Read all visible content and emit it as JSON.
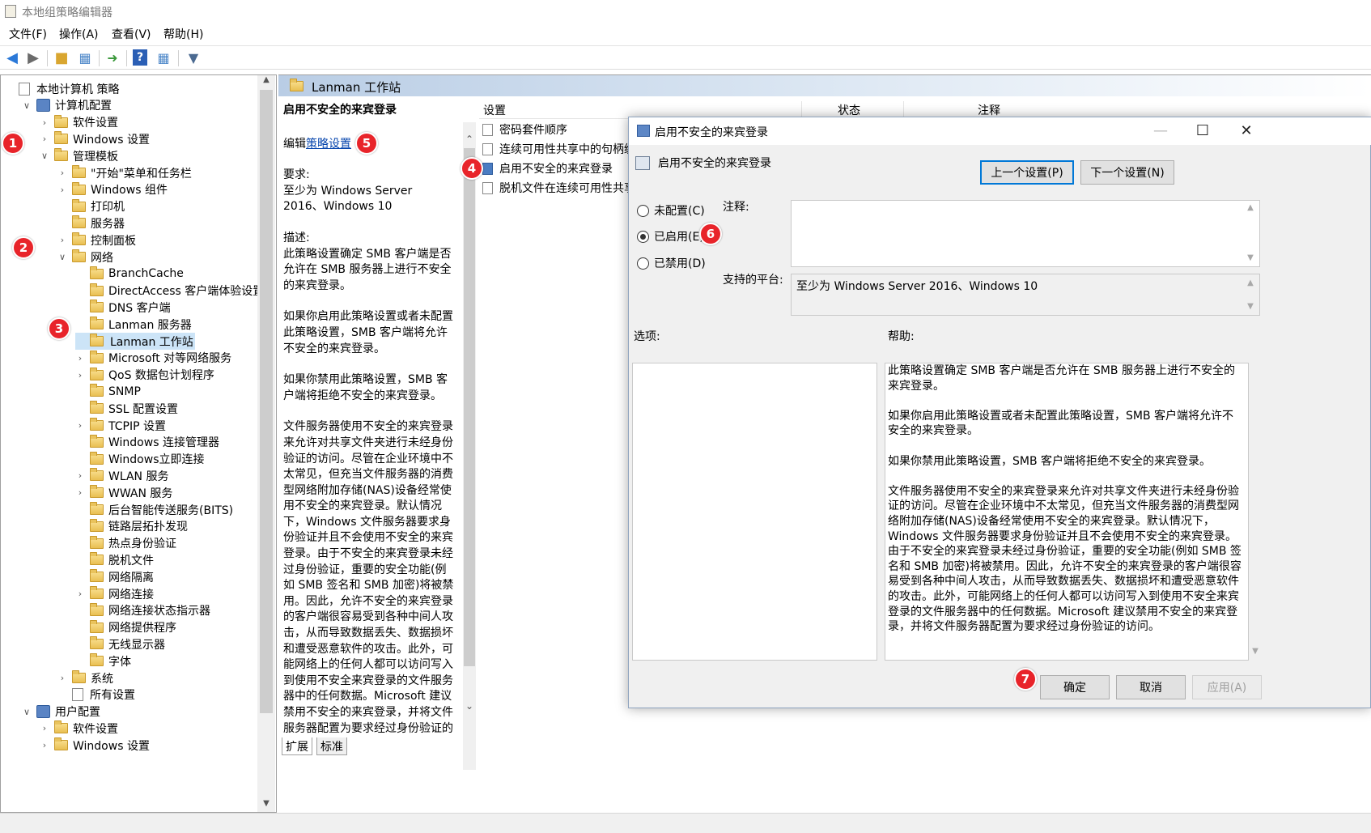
{
  "window": {
    "title": "本地组策略编辑器"
  },
  "menu": [
    "文件(F)",
    "操作(A)",
    "查看(V)",
    "帮助(H)"
  ],
  "toolbar_icons": [
    "back-icon",
    "forward-icon",
    "up-folder-icon",
    "show-hide-tree-icon",
    "export-list-icon",
    "help-icon",
    "show-hide-pane-icon",
    "filter-icon"
  ],
  "tree": [
    {
      "label": "本地计算机 策略",
      "depth": 0,
      "chev": "",
      "icon": "doc"
    },
    {
      "label": "计算机配置",
      "depth": 1,
      "chev": "v",
      "icon": "node"
    },
    {
      "label": "软件设置",
      "depth": 2,
      "chev": ">",
      "icon": "folder"
    },
    {
      "label": "Windows 设置",
      "depth": 2,
      "chev": ">",
      "icon": "folder"
    },
    {
      "label": "管理模板",
      "depth": 2,
      "chev": "v",
      "icon": "folder"
    },
    {
      "label": "\"开始\"菜单和任务栏",
      "depth": 3,
      "chev": ">",
      "icon": "folder"
    },
    {
      "label": "Windows 组件",
      "depth": 3,
      "chev": ">",
      "icon": "folder"
    },
    {
      "label": "打印机",
      "depth": 3,
      "chev": "",
      "icon": "folder"
    },
    {
      "label": "服务器",
      "depth": 3,
      "chev": "",
      "icon": "folder"
    },
    {
      "label": "控制面板",
      "depth": 3,
      "chev": ">",
      "icon": "folder"
    },
    {
      "label": "网络",
      "depth": 3,
      "chev": "v",
      "icon": "folder"
    },
    {
      "label": "BranchCache",
      "depth": 4,
      "chev": "",
      "icon": "folder"
    },
    {
      "label": "DirectAccess 客户端体验设置",
      "depth": 4,
      "chev": "",
      "icon": "folder"
    },
    {
      "label": "DNS 客户端",
      "depth": 4,
      "chev": "",
      "icon": "folder"
    },
    {
      "label": "Lanman 服务器",
      "depth": 4,
      "chev": "",
      "icon": "folder"
    },
    {
      "label": "Lanman 工作站",
      "depth": 4,
      "chev": "",
      "icon": "folder",
      "selected": true
    },
    {
      "label": "Microsoft 对等网络服务",
      "depth": 4,
      "chev": ">",
      "icon": "folder"
    },
    {
      "label": "QoS 数据包计划程序",
      "depth": 4,
      "chev": ">",
      "icon": "folder"
    },
    {
      "label": "SNMP",
      "depth": 4,
      "chev": "",
      "icon": "folder"
    },
    {
      "label": "SSL 配置设置",
      "depth": 4,
      "chev": "",
      "icon": "folder"
    },
    {
      "label": "TCPIP 设置",
      "depth": 4,
      "chev": ">",
      "icon": "folder"
    },
    {
      "label": "Windows 连接管理器",
      "depth": 4,
      "chev": "",
      "icon": "folder"
    },
    {
      "label": "Windows立即连接",
      "depth": 4,
      "chev": "",
      "icon": "folder"
    },
    {
      "label": "WLAN 服务",
      "depth": 4,
      "chev": ">",
      "icon": "folder"
    },
    {
      "label": "WWAN 服务",
      "depth": 4,
      "chev": ">",
      "icon": "folder"
    },
    {
      "label": "后台智能传送服务(BITS)",
      "depth": 4,
      "chev": "",
      "icon": "folder"
    },
    {
      "label": "链路层拓扑发现",
      "depth": 4,
      "chev": "",
      "icon": "folder"
    },
    {
      "label": "热点身份验证",
      "depth": 4,
      "chev": "",
      "icon": "folder"
    },
    {
      "label": "脱机文件",
      "depth": 4,
      "chev": "",
      "icon": "folder"
    },
    {
      "label": "网络隔离",
      "depth": 4,
      "chev": "",
      "icon": "folder"
    },
    {
      "label": "网络连接",
      "depth": 4,
      "chev": ">",
      "icon": "folder"
    },
    {
      "label": "网络连接状态指示器",
      "depth": 4,
      "chev": "",
      "icon": "folder"
    },
    {
      "label": "网络提供程序",
      "depth": 4,
      "chev": "",
      "icon": "folder"
    },
    {
      "label": "无线显示器",
      "depth": 4,
      "chev": "",
      "icon": "folder"
    },
    {
      "label": "字体",
      "depth": 4,
      "chev": "",
      "icon": "folder"
    },
    {
      "label": "系统",
      "depth": 3,
      "chev": ">",
      "icon": "folder"
    },
    {
      "label": "所有设置",
      "depth": 3,
      "chev": "",
      "icon": "doc"
    },
    {
      "label": "用户配置",
      "depth": 1,
      "chev": "v",
      "icon": "node"
    },
    {
      "label": "软件设置",
      "depth": 2,
      "chev": ">",
      "icon": "folder"
    },
    {
      "label": "Windows 设置",
      "depth": 2,
      "chev": ">",
      "icon": "folder"
    }
  ],
  "pane": {
    "header": "Lanman 工作站",
    "desc_title": "启用不安全的来宾登录",
    "edit_prefix": "编辑",
    "edit_link": "策略设置",
    "req_label": "要求:",
    "req_text": "至少为 Windows Server 2016、Windows 10",
    "desc_label": "描述:",
    "desc_p1": "此策略设置确定 SMB 客户端是否允许在 SMB 服务器上进行不安全的来宾登录。",
    "desc_p2": "如果你启用此策略设置或者未配置此策略设置，SMB 客户端将允许不安全的来宾登录。",
    "desc_p3": "如果你禁用此策略设置，SMB 客户端将拒绝不安全的来宾登录。",
    "desc_p4": "文件服务器使用不安全的来宾登录来允许对共享文件夹进行未经身份验证的访问。尽管在企业环境中不太常见，但充当文件服务器的消费型网络附加存储(NAS)设备经常使用不安全的来宾登录。默认情况下，Windows 文件服务器要求身份验证并且不会使用不安全的来宾登录。由于不安全的来宾登录未经过身份验证，重要的安全功能(例如 SMB 签名和 SMB 加密)将被禁用。因此，允许不安全的来宾登录的客户端很容易受到各种中间人攻击，从而导致数据丢失、数据损坏和遭受恶意软件的攻击。此外，可能网络上的任何人都可以访问写入到使用不安全来宾登录的文件服务器中的任何数据。Microsoft 建议禁用不安全的来宾登录，并将文件服务器配置为要求经过身份验证的访问。",
    "columns": {
      "setting": "设置",
      "state": "状态",
      "comment": "注释"
    },
    "rows": [
      "密码套件顺序",
      "连续可用性共享中的句柄缓存",
      "启用不安全的来宾登录",
      "脱机文件在连续可用性共享上的可用性"
    ],
    "tabs": [
      "扩展",
      "标准"
    ]
  },
  "dialog": {
    "title": "启用不安全的来宾登录",
    "subtitle": "启用不安全的来宾登录",
    "prev": "上一个设置(P)",
    "next": "下一个设置(N)",
    "radio_nc": "未配置(C)",
    "radio_en": "已启用(E)",
    "radio_dis": "已禁用(D)",
    "comment_label": "注释:",
    "platform_label": "支持的平台:",
    "platform_value": "至少为 Windows Server 2016、Windows 10",
    "options_label": "选项:",
    "help_label": "帮助:",
    "help_p1": "此策略设置确定 SMB 客户端是否允许在 SMB 服务器上进行不安全的来宾登录。",
    "help_p2": "如果你启用此策略设置或者未配置此策略设置，SMB 客户端将允许不安全的来宾登录。",
    "help_p3": "如果你禁用此策略设置，SMB 客户端将拒绝不安全的来宾登录。",
    "help_p4": "文件服务器使用不安全的来宾登录来允许对共享文件夹进行未经身份验证的访问。尽管在企业环境中不太常见，但充当文件服务器的消费型网络附加存储(NAS)设备经常使用不安全的来宾登录。默认情况下，Windows 文件服务器要求身份验证并且不会使用不安全的来宾登录。由于不安全的来宾登录未经过身份验证，重要的安全功能(例如 SMB 签名和 SMB 加密)将被禁用。因此，允许不安全的来宾登录的客户端很容易受到各种中间人攻击，从而导致数据丢失、数据损坏和遭受恶意软件的攻击。此外，可能网络上的任何人都可以访问写入到使用不安全来宾登录的文件服务器中的任何数据。Microsoft 建议禁用不安全的来宾登录，并将文件服务器配置为要求经过身份验证的访问。",
    "ok": "确定",
    "cancel": "取消",
    "apply": "应用(A)"
  },
  "markers": [
    "1",
    "2",
    "3",
    "4",
    "5",
    "6",
    "7"
  ],
  "colors": {
    "marker": "#e8242a",
    "selection": "#cce4f7",
    "link": "#0645ad",
    "focus": "#0078d7"
  }
}
